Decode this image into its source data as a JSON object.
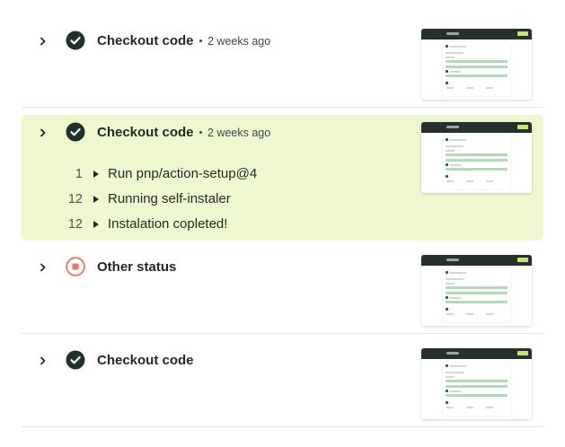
{
  "runs": [
    {
      "title": "Checkout code",
      "time": "2 weeks ago",
      "status": "success",
      "expanded": false
    },
    {
      "title": "Checkout code",
      "time": "2 weeks ago",
      "status": "success",
      "expanded": true,
      "steps": [
        {
          "num": "1",
          "text": "Run pnp/action-setup@4"
        },
        {
          "num": "12",
          "text": "Running self-instaler"
        },
        {
          "num": "12",
          "text": "Instalation copleted!"
        }
      ]
    },
    {
      "title": "Other status",
      "status": "stopped",
      "expanded": false
    },
    {
      "title": "Checkout code",
      "status": "success",
      "expanded": false
    }
  ],
  "colors": {
    "success": "#22302c",
    "stopped": "#e9756a",
    "active_bg": "#eef7cf",
    "accent": "#c6ea63"
  },
  "icons": {
    "expand": "chevron-right-icon",
    "success": "check-circle-icon",
    "stopped": "stop-circle-icon",
    "step": "play-triangle-icon"
  }
}
